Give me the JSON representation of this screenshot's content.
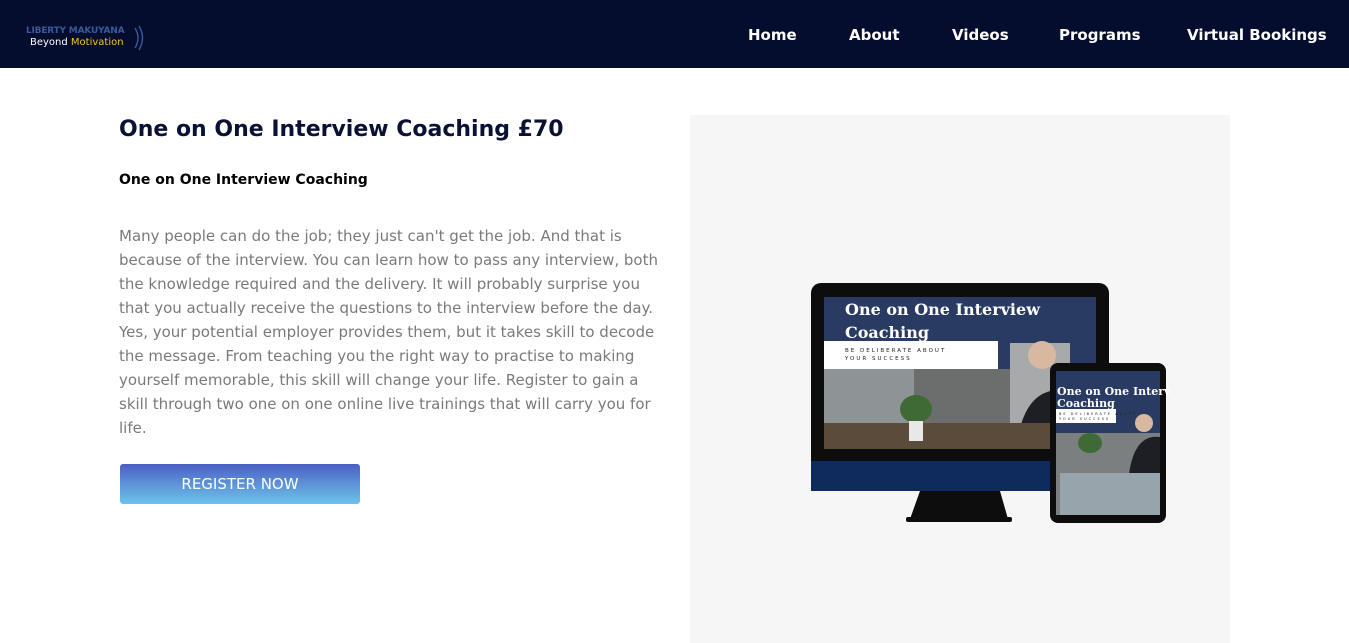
{
  "brand": {
    "name": "LIBERTY MAKUYANA",
    "tagline_prefix": "Beyond",
    "tagline_accent": "Motivation"
  },
  "nav": {
    "items": [
      "Home",
      "About",
      "Videos",
      "Programs",
      "Virtual Bookings"
    ]
  },
  "main": {
    "title": "One on One Interview Coaching £70",
    "subtitle": "One on One Interview Coaching",
    "body": "Many people can do the job; they just can't get the job. And that is because of the interview. You can learn how to pass any interview, both the knowledge required and the delivery. It will probably surprise you that you actually receive the questions to the interview before the day. Yes, your potential employer provides them, but it takes skill to decode the message. From teaching you the right way to practise to making yourself memorable, this skill will change your life. Register to gain a skill through two one on one online live trainings that will carry you for life.",
    "cta_label": "REGISTER NOW"
  },
  "mockup": {
    "title_line1": "One on One Interview",
    "title_line2": "Coaching",
    "tag_line1": "BE DELIBERATE ABOUT",
    "tag_line2": "YOUR SUCCESS",
    "tablet_title_line1": "One on One Interview",
    "tablet_title_line2": "Coaching",
    "tablet_tag_line1": "BE DELIBERATE ABOUT",
    "tablet_tag_line2": "YOUR SUCCESS"
  },
  "colors": {
    "nav_bg": "#050d2e",
    "title": "#0a1133",
    "body_text": "#7a7a7a",
    "accent": "#f2c230",
    "cta_gradient_top": "#4a5fc2",
    "cta_gradient_bottom": "#6cc3ea"
  }
}
